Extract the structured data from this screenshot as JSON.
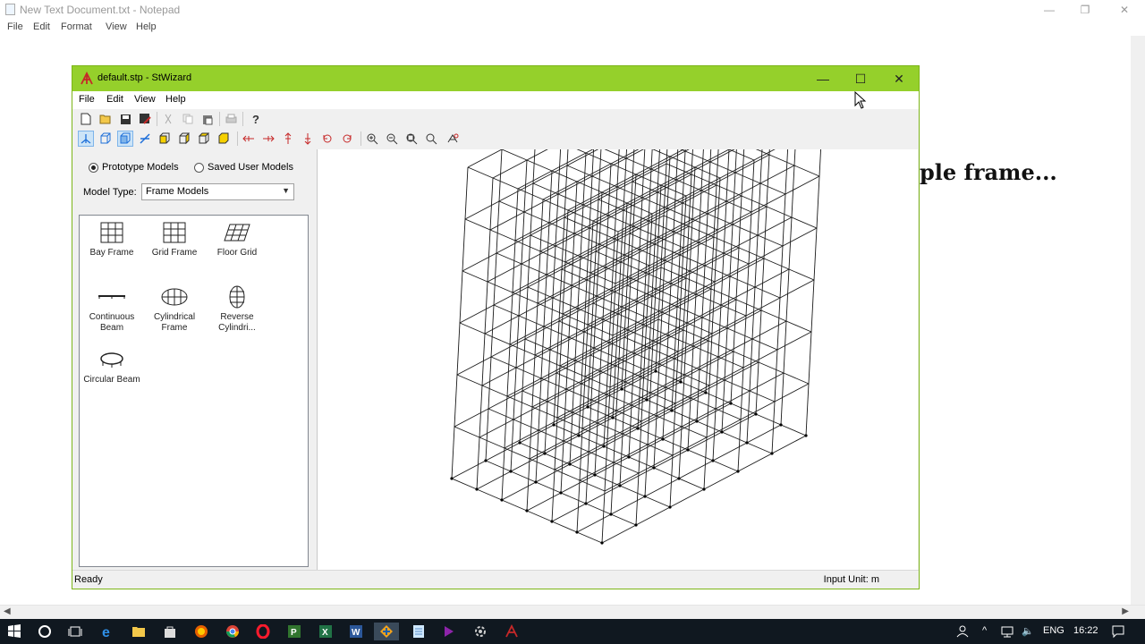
{
  "notepad": {
    "title": "New Text Document.txt - Notepad",
    "menu": [
      "File",
      "Edit",
      "Format",
      "View",
      "Help"
    ],
    "content_text": "ple frame...",
    "controls": {
      "minimize": "—",
      "restore": "❐",
      "close": "✕"
    }
  },
  "stwizard": {
    "title": "default.stp - StWizard",
    "menu": [
      "File",
      "Edit",
      "View",
      "Help"
    ],
    "radio_prototype": "Prototype Models",
    "radio_saved": "Saved User Models",
    "model_type_label": "Model Type:",
    "model_type_value": "Frame Models",
    "models": [
      {
        "line1": "Bay Frame",
        "line2": ""
      },
      {
        "line1": "Grid Frame",
        "line2": ""
      },
      {
        "line1": "Floor Grid",
        "line2": ""
      },
      {
        "line1": "Continuous",
        "line2": "Beam"
      },
      {
        "line1": "Cylindrical",
        "line2": "Frame"
      },
      {
        "line1": "Reverse",
        "line2": "Cylindri..."
      },
      {
        "line1": "Circular Beam",
        "line2": ""
      }
    ],
    "status_left": "Ready",
    "status_right": "Input Unit:   m",
    "accent_color": "#95d02b"
  },
  "taskbar": {
    "lang": "ENG",
    "time": "16:22"
  }
}
